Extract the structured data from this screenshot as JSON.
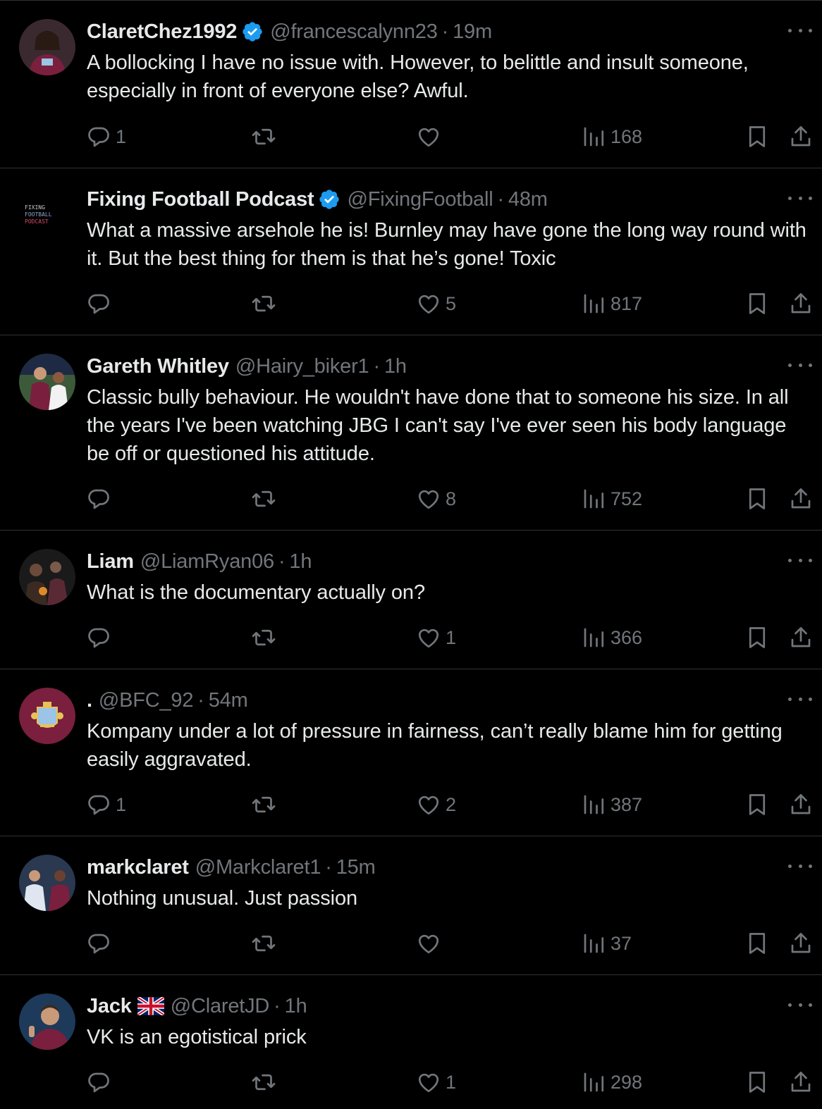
{
  "colors": {
    "background": "#000000",
    "text_primary": "#e7e9ea",
    "text_secondary": "#71767b",
    "verified_blue": "#1d9bf0",
    "divider": "#2f3336"
  },
  "icons": {
    "reply": "reply-icon",
    "retweet": "retweet-icon",
    "like": "heart-icon",
    "views": "views-icon",
    "bookmark": "bookmark-icon",
    "share": "share-icon",
    "more": "more-icon",
    "verified": "verified-badge-icon"
  },
  "tweets": [
    {
      "name": "ClaretChez1992",
      "verified": true,
      "handle": "@francescalynn23",
      "separator": "·",
      "time": "19m",
      "text": "A bollocking I have no issue with. However, to belittle and insult someone, especially in front of everyone else? Awful.",
      "replies": "1",
      "retweets": "",
      "likes": "",
      "views": "168"
    },
    {
      "name": "Fixing Football Podcast",
      "verified": true,
      "handle": "@FixingFootball",
      "separator": "·",
      "time": "48m",
      "text": "What a massive arsehole he is! Burnley may have gone the long way round with it. But the best thing for them is that he’s gone! Toxic",
      "avatar_text": [
        "FIXING",
        "FOOTBALL",
        "PODCAST"
      ],
      "replies": "",
      "retweets": "",
      "likes": "5",
      "views": "817"
    },
    {
      "name": "Gareth Whitley",
      "verified": false,
      "handle": "@Hairy_biker1",
      "separator": "·",
      "time": "1h",
      "text": "Classic bully behaviour. He wouldn't have done that to someone his size. In all the years I've been watching JBG I can't say I've ever seen his body language be off or questioned his attitude.",
      "replies": "",
      "retweets": "",
      "likes": "8",
      "views": "752"
    },
    {
      "name": "Liam",
      "verified": false,
      "handle": "@LiamRyan06",
      "separator": "·",
      "time": "1h",
      "text": "What is the documentary actually on?",
      "replies": "",
      "retweets": "",
      "likes": "1",
      "views": "366"
    },
    {
      "name": ".",
      "verified": false,
      "handle": "@BFC_92",
      "separator": "·",
      "time": "54m",
      "text": "Kompany under a lot of pressure in fairness, can’t really blame him for getting easily aggravated.",
      "replies": "1",
      "retweets": "",
      "likes": "2",
      "views": "387"
    },
    {
      "name": "markclaret",
      "verified": false,
      "handle": "@Markclaret1",
      "separator": "·",
      "time": "15m",
      "text": "Nothing unusual. Just passion",
      "replies": "",
      "retweets": "",
      "likes": "",
      "views": "37"
    },
    {
      "name": "Jack",
      "verified": false,
      "flag": "uk-flag-icon",
      "handle": "@ClaretJD",
      "separator": "·",
      "time": "1h",
      "text": "VK is an egotistical prick",
      "replies": "",
      "retweets": "",
      "likes": "1",
      "views": "298"
    }
  ]
}
